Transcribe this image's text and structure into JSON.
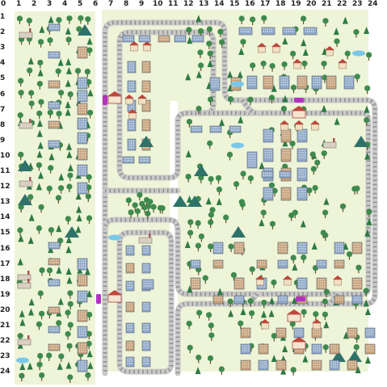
{
  "grid": {
    "columns": [
      "0",
      "1",
      "2",
      "3",
      "4",
      "5",
      "6",
      "7",
      "8",
      "9",
      "10",
      "11",
      "12",
      "13",
      "14",
      "15",
      "16",
      "17",
      "18",
      "19",
      "20",
      "21",
      "22",
      "23",
      "24"
    ],
    "rows": [
      "1",
      "2",
      "3",
      "4",
      "5",
      "6",
      "7",
      "8",
      "9",
      "10",
      "11",
      "12",
      "13",
      "14",
      "15",
      "16",
      "17",
      "18",
      "19",
      "20",
      "21",
      "22",
      "23",
      "24"
    ]
  },
  "colors": {
    "grass": "#eef4d8",
    "board_bg": "#ffffff",
    "rail": "#c9c9c9",
    "tie": "#8f8f8f",
    "tree": "#3f8a4e",
    "building_blue": "#8fa9c9",
    "building_brown": "#c8a27a",
    "roof_red": "#c0463a",
    "water": "#79c7ea",
    "mountain": "#2f7269",
    "train_purple": "#b531c4"
  },
  "icons": [
    "tree-icon",
    "pine-icon",
    "house-icon",
    "apartment-icon",
    "station-icon",
    "factory-icon",
    "mountain-icon",
    "pond-icon",
    "train-icon"
  ]
}
